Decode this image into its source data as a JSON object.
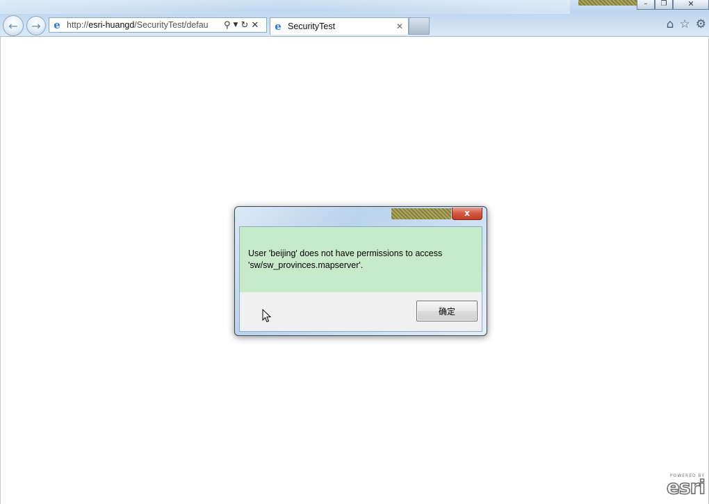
{
  "browser": {
    "url_prefix": "http://",
    "url_host": "esri-huangd",
    "url_path": "/SecurityTest/defau",
    "tab_title": "SecurityTest",
    "icons": {
      "back": "back-arrow-icon",
      "forward": "forward-arrow-icon",
      "search": "search-icon",
      "refresh": "refresh-icon",
      "stop": "stop-icon",
      "home": "home-icon",
      "favorites": "star-icon",
      "tools": "gear-icon"
    }
  },
  "dialog": {
    "message": "User 'beijing' does not have permissions to access 'sw/sw_provinces.mapserver'.",
    "ok_label": "确定",
    "close_label": "x",
    "message_bg": "#c7ebc9"
  },
  "watermark": {
    "powered_by": "POWERED BY",
    "brand": "esri"
  }
}
